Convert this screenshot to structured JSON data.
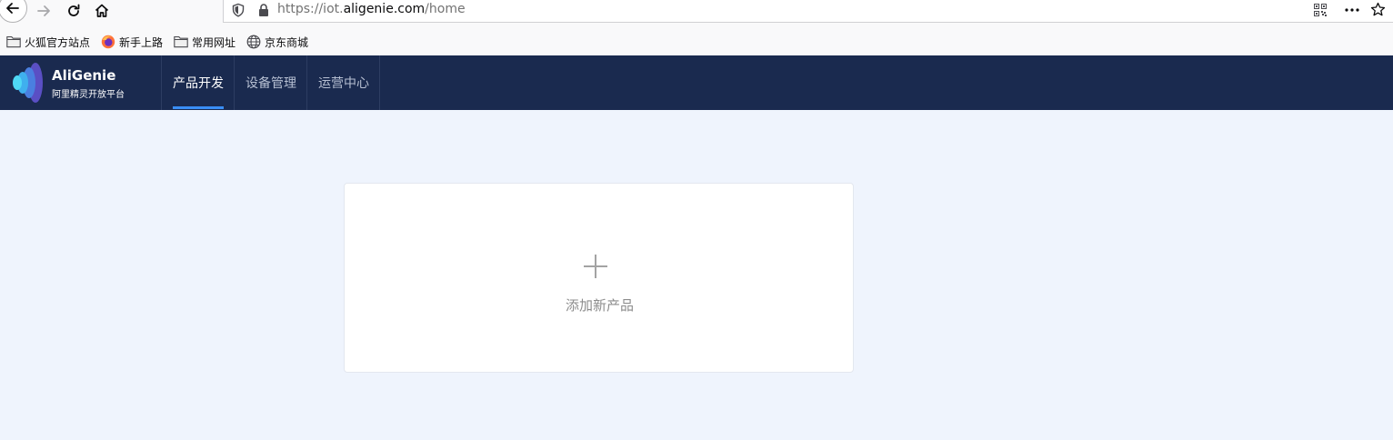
{
  "browser": {
    "url": {
      "prefix": "https://iot.",
      "domain": "aligenie.com",
      "path": "/home"
    },
    "icons": {
      "back": "back-arrow-icon",
      "forward": "forward-arrow-icon",
      "reload": "reload-icon",
      "home": "home-icon",
      "shield": "shield-icon",
      "lock": "lock-icon",
      "qr": "qr-code-icon",
      "more": "more-actions-icon",
      "bookmark": "star-icon"
    }
  },
  "bookmarks": [
    {
      "label": "火狐官方站点",
      "icon": "folder-icon"
    },
    {
      "label": "新手上路",
      "icon": "firefox-icon"
    },
    {
      "label": "常用网址",
      "icon": "folder-icon"
    },
    {
      "label": "京东商城",
      "icon": "globe-icon"
    }
  ],
  "app": {
    "brand": {
      "title": "AliGenie",
      "subtitle": "阿里精灵开放平台"
    },
    "nav": [
      {
        "label": "产品开发",
        "active": true
      },
      {
        "label": "设备管理",
        "active": false
      },
      {
        "label": "运营中心",
        "active": false
      }
    ],
    "colors": {
      "header_bg": "#1a2a4f",
      "accent": "#3a8ef6",
      "page_bg": "#eff4fd"
    }
  },
  "main": {
    "add_card": {
      "label": "添加新产品",
      "icon": "plus-icon"
    }
  }
}
